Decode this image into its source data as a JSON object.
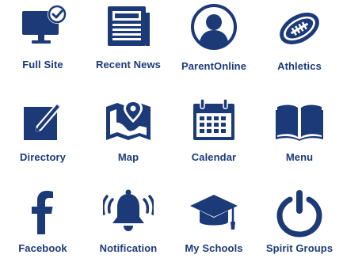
{
  "colors": {
    "icon": "#1c3a78",
    "label": "#1c3a78",
    "background": "#ffffff"
  },
  "tiles": [
    {
      "label": "Full Site",
      "icon": "monitor-check-icon"
    },
    {
      "label": "Recent News",
      "icon": "newspaper-icon"
    },
    {
      "label": "ParentOnline",
      "icon": "parent-avatar-icon"
    },
    {
      "label": "Athletics",
      "icon": "football-icon"
    },
    {
      "label": "Directory",
      "icon": "edit-pencil-icon"
    },
    {
      "label": "Map",
      "icon": "map-pin-icon"
    },
    {
      "label": "Calendar",
      "icon": "calendar-icon"
    },
    {
      "label": "Menu",
      "icon": "open-book-icon"
    },
    {
      "label": "Facebook",
      "icon": "facebook-icon"
    },
    {
      "label": "Notification",
      "icon": "bell-icon"
    },
    {
      "label": "My Schools",
      "icon": "graduation-cap-icon"
    },
    {
      "label": "Spirit Groups",
      "icon": "power-icon"
    }
  ]
}
